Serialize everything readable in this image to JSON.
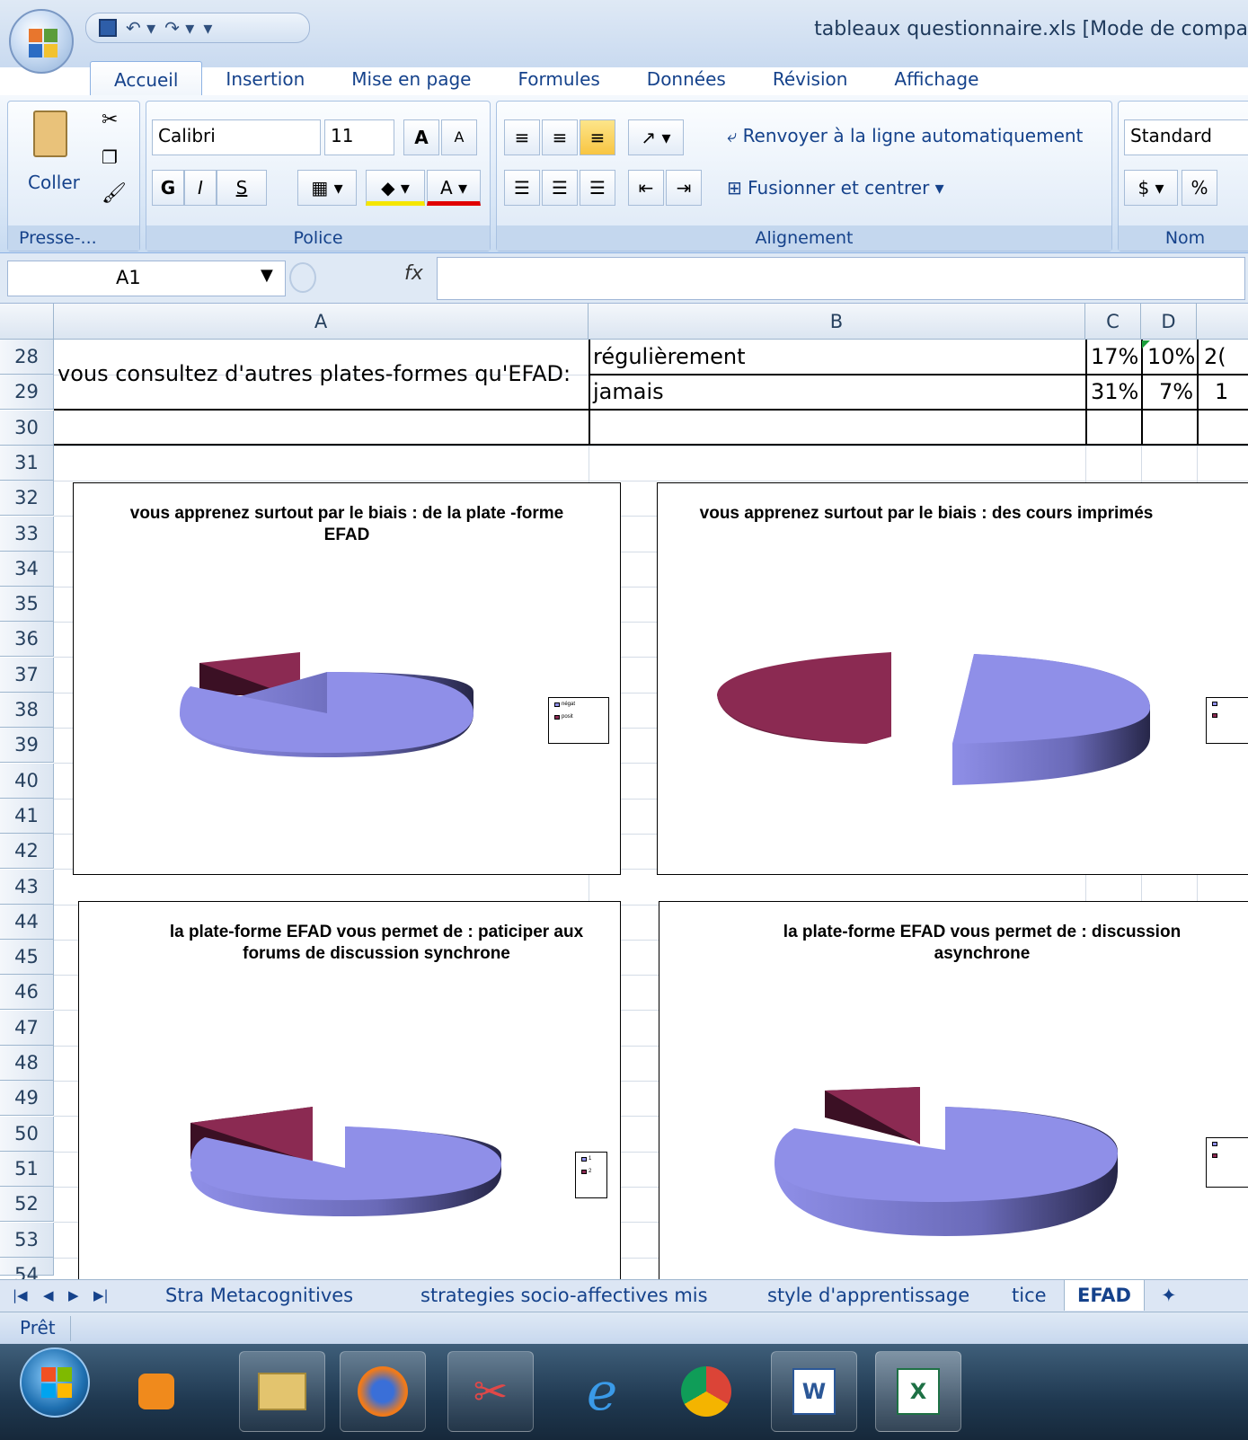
{
  "window": {
    "title": "tableaux questionnaire.xls  [Mode de compa"
  },
  "ribbon": {
    "tabs": [
      "Accueil",
      "Insertion",
      "Mise en page",
      "Formules",
      "Données",
      "Révision",
      "Affichage"
    ],
    "active_tab": "Accueil",
    "clipboard": {
      "paste_label": "Coller",
      "group_label": "Presse-..."
    },
    "font": {
      "name": "Calibri",
      "size": "11",
      "bold": "G",
      "italic": "I",
      "underline": "S",
      "group_label": "Police"
    },
    "alignment": {
      "wrap_label": "Renvoyer à la ligne automatiquement",
      "merge_label": "Fusionner et centrer",
      "group_label": "Alignement"
    },
    "number": {
      "format": "Standard",
      "percent": "%",
      "group_label": "Nom"
    }
  },
  "formula_bar": {
    "cell_ref": "A1",
    "fx_label": "fx",
    "content": ""
  },
  "columns": [
    "A",
    "B",
    "C",
    "D"
  ],
  "rows": [
    "28",
    "29",
    "30",
    "31",
    "32",
    "33",
    "34",
    "35",
    "36",
    "37",
    "38",
    "39",
    "40",
    "41",
    "42",
    "43",
    "44",
    "45",
    "46",
    "47",
    "48",
    "49",
    "50",
    "51",
    "52",
    "53",
    "54"
  ],
  "cells": {
    "a28": "vous consultez d'autres plates-formes qu'EFAD:",
    "b28": "régulièrement",
    "c28": "17%",
    "d28": "10%",
    "e28": "2(",
    "b29": "jamais",
    "c29": "31%",
    "d29": "7%",
    "e29": "1"
  },
  "colors": {
    "slice_blue": "#8f8fe8",
    "slice_maroon": "#8b2a52"
  },
  "charts": [
    {
      "title": "vous apprenez surtout par le biais : de la plate -forme EFAD",
      "legend": [
        "négat",
        "posit"
      ]
    },
    {
      "title": "vous apprenez surtout par le biais : des cours imprimés",
      "legend": [
        "",
        ""
      ]
    },
    {
      "title": "la plate-forme EFAD vous permet de : paticiper aux forums de discussion synchrone",
      "legend": [
        "1",
        "2"
      ]
    },
    {
      "title": "la plate-forme EFAD vous permet de : discussion asynchrone",
      "legend": [
        "",
        ""
      ]
    }
  ],
  "sheet_tabs": [
    "Stra Metacognitives",
    "strategies socio-affectives mis",
    "style d'apprentissage",
    "tice",
    "EFAD"
  ],
  "active_sheet": "EFAD",
  "status": "Prêt"
}
